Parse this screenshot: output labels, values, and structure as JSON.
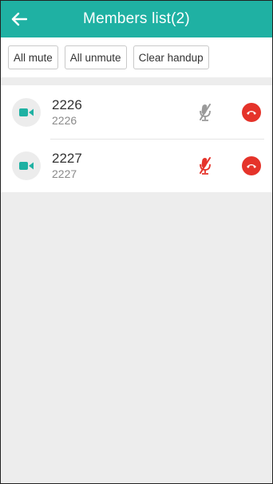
{
  "header": {
    "title": "Members list(2)",
    "back_icon": "arrow-left-icon"
  },
  "toolbar": {
    "all_mute_label": "All mute",
    "all_unmute_label": "All unmute",
    "clear_handup_label": "Clear handup"
  },
  "members": [
    {
      "name": "2226",
      "number": "2226",
      "mic_state": "muted-gray",
      "avatar_icon": "video-camera-icon"
    },
    {
      "name": "2227",
      "number": "2227",
      "mic_state": "muted-red",
      "avatar_icon": "video-camera-icon"
    }
  ],
  "colors": {
    "accent": "#1fb1a3",
    "hangup": "#e5332a",
    "mic_gray": "#9a9a9a",
    "mic_red": "#e5332a"
  }
}
